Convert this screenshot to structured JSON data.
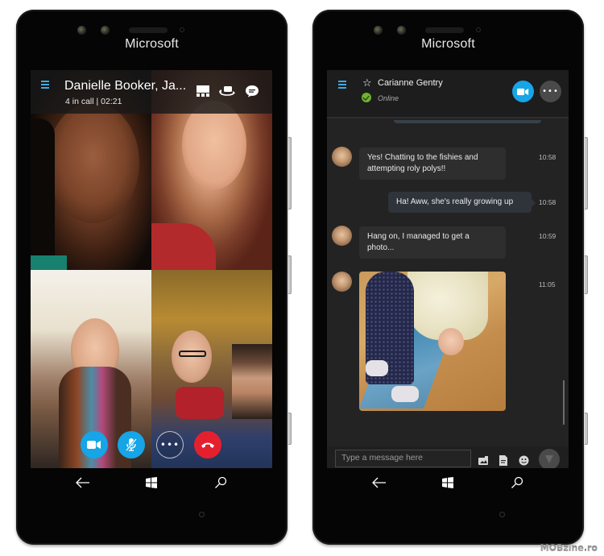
{
  "phones": [
    {
      "brand": "Microsoft",
      "app": "Skype video call",
      "call_header": {
        "title": "Danielle Booker, Ja...",
        "subtitle": "4 in call | 02:21",
        "icons": [
          "layout-grid-icon",
          "switch-camera-icon",
          "chat-icon"
        ]
      },
      "participants": [
        {
          "position": "top-left",
          "description": "woman with dark braided hair, close-up"
        },
        {
          "position": "top-right",
          "description": "woman with long auburn hair smiling"
        },
        {
          "position": "bottom-left",
          "description": "woman with scarf smiling outdoors"
        },
        {
          "position": "bottom-right",
          "description": "woman with glasses holding a dog"
        },
        {
          "position": "self-view",
          "description": "woman with dark hair, picture-in-picture"
        }
      ],
      "call_controls": [
        {
          "name": "video",
          "icon": "video-camera-icon",
          "color": "#16a5e6"
        },
        {
          "name": "mute",
          "icon": "microphone-muted-icon",
          "color": "#16a5e6"
        },
        {
          "name": "more",
          "icon": "more-dots-icon",
          "color": "transparent"
        },
        {
          "name": "end-call",
          "icon": "hang-up-icon",
          "color": "#e5202e"
        }
      ],
      "nav": [
        "back-arrow-icon",
        "windows-start-icon",
        "search-icon"
      ]
    },
    {
      "brand": "Microsoft",
      "app": "Skype chat",
      "chat_header": {
        "contact_name": "Carianne Gentry",
        "status": "Online",
        "status_color": "#6cb52d",
        "favorite_icon": "star-outline-icon",
        "video_call_icon": "video-camera-icon",
        "more_icon": "more-dots-icon"
      },
      "messages": [
        {
          "direction": "incoming",
          "text": "Yes! Chatting to the fishies and attempting roly polys!!",
          "time": "10:58"
        },
        {
          "direction": "outgoing",
          "text": "Ha! Aww, she's really growing up",
          "time": "10:58"
        },
        {
          "direction": "incoming",
          "text": "Hang on, I managed to get a photo...",
          "time": "10:59"
        },
        {
          "direction": "incoming",
          "type": "photo",
          "description": "toddler bending over on a wooden floor",
          "time": "11:05"
        }
      ],
      "composer": {
        "placeholder": "Type a message here",
        "icons": [
          "media-icon",
          "file-icon",
          "emoji-icon",
          "send-icon"
        ]
      },
      "nav": [
        "back-arrow-icon",
        "windows-start-icon",
        "search-icon"
      ]
    }
  ],
  "colors": {
    "skype_blue": "#16a5e6",
    "end_call_red": "#e5202e",
    "chat_bg": "#232323",
    "online_green": "#6cb52d"
  },
  "watermark": "MOBzine.ro"
}
